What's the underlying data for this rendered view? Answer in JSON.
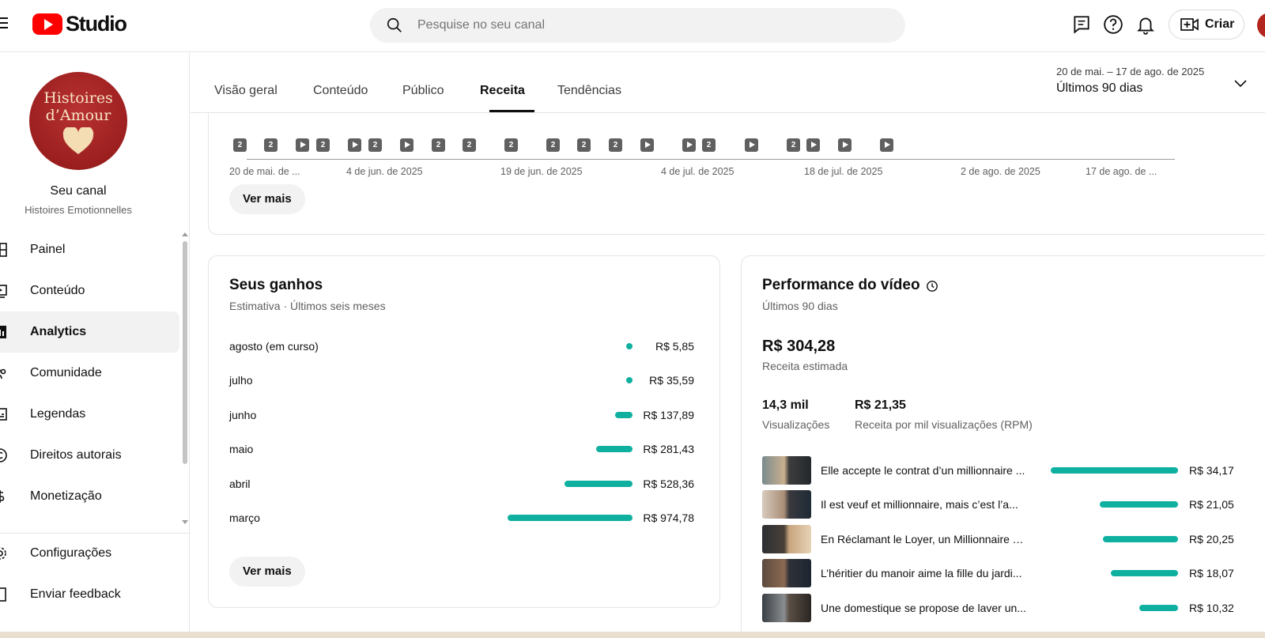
{
  "header": {
    "brand": "Studio",
    "search_placeholder": "Pesquise no seu canal",
    "create_label": "Criar"
  },
  "sidebar": {
    "avatar_text": "Histoires d’Amour",
    "channel_title": "Seu canal",
    "channel_name": "Histoires Emotionnelles",
    "items": [
      {
        "label": "Painel",
        "icon": "dashboard-icon"
      },
      {
        "label": "Conteúdo",
        "icon": "content-icon"
      },
      {
        "label": "Analytics",
        "icon": "analytics-icon",
        "active": true
      },
      {
        "label": "Comunidade",
        "icon": "community-icon"
      },
      {
        "label": "Legendas",
        "icon": "subtitles-icon"
      },
      {
        "label": "Direitos autorais",
        "icon": "copyright-icon"
      },
      {
        "label": "Monetização",
        "icon": "monetization-icon"
      }
    ],
    "bottom_items": [
      {
        "label": "Configurações",
        "icon": "gear-icon"
      },
      {
        "label": "Enviar feedback",
        "icon": "feedback-icon"
      }
    ]
  },
  "tabs": [
    {
      "label": "Visão geral"
    },
    {
      "label": "Conteúdo"
    },
    {
      "label": "Público"
    },
    {
      "label": "Receita",
      "active": true
    },
    {
      "label": "Tendências"
    }
  ],
  "date_range": {
    "dates": "20 de mai. – 17 de ago. de 2025",
    "label": "Últimos 90 dias"
  },
  "timeline": {
    "marker_count_label": "2",
    "axis_labels": [
      "20 de mai. de ...",
      "4 de jun. de 2025",
      "19 de jun. de 2025",
      "4 de jul. de 2025",
      "18 de jul. de 2025",
      "2 de ago. de 2025",
      "17 de ago. de ..."
    ],
    "see_more": "Ver mais"
  },
  "earnings": {
    "title": "Seus ganhos",
    "subtitle": "Estimativa · Últimos seis meses",
    "rows": [
      {
        "month": "agosto (em curso)",
        "value": "R$ 5,85",
        "amount": 5.85
      },
      {
        "month": "julho",
        "value": "R$ 35,59",
        "amount": 35.59
      },
      {
        "month": "junho",
        "value": "R$ 137,89",
        "amount": 137.89
      },
      {
        "month": "maio",
        "value": "R$ 281,43",
        "amount": 281.43
      },
      {
        "month": "abril",
        "value": "R$ 528,36",
        "amount": 528.36
      },
      {
        "month": "março",
        "value": "R$ 974,78",
        "amount": 974.78
      }
    ],
    "see_more": "Ver mais"
  },
  "performance": {
    "title": "Performance do vídeo",
    "subtitle": "Últimos 90 dias",
    "revenue_value": "R$ 304,28",
    "revenue_label": "Receita estimada",
    "views_value": "14,3 mil",
    "views_label": "Visualizações",
    "rpm_value": "R$ 21,35",
    "rpm_label": "Receita por mil visualizações (RPM)",
    "videos": [
      {
        "title": "Elle accepte le contrat d’un millionnaire ...",
        "value": "R$ 34,17",
        "amount": 34.17
      },
      {
        "title": "Il est veuf et millionnaire, mais c’est l’a...",
        "value": "R$ 21,05",
        "amount": 21.05
      },
      {
        "title": "En Réclamant le Loyer, un Millionnaire T...",
        "value": "R$ 20,25",
        "amount": 20.25
      },
      {
        "title": "L’héritier du manoir aime la fille du jardi...",
        "value": "R$ 18,07",
        "amount": 18.07
      },
      {
        "title": "Une domestique se propose de laver un...",
        "value": "R$ 10,32",
        "amount": 10.32
      }
    ]
  },
  "colors": {
    "accent_bar": "#10b0a0",
    "brand_red": "#ff0000"
  }
}
